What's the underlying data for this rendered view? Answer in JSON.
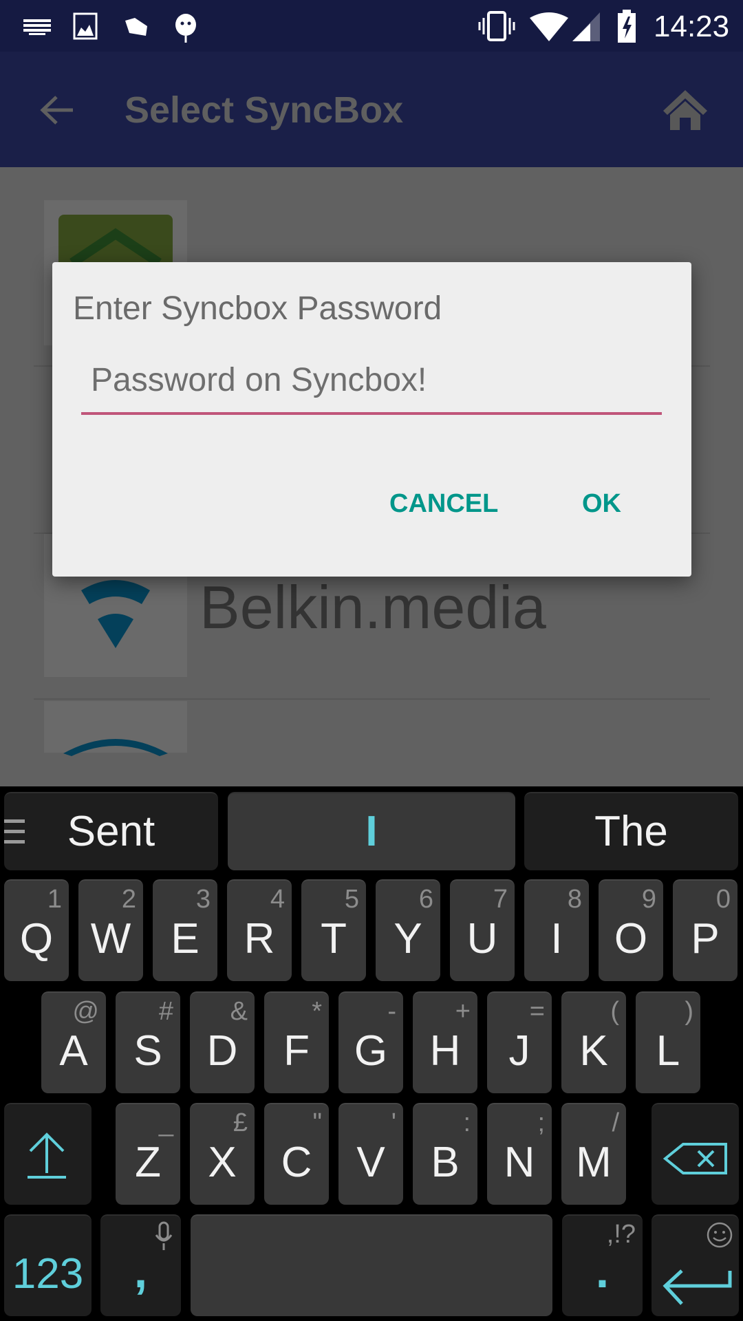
{
  "status_bar": {
    "time": "14:23",
    "left_icons": [
      "keyboard-icon",
      "image-icon",
      "cloud-icon",
      "android-debug-icon"
    ],
    "right_icons": [
      "vibrate-icon",
      "wifi-icon",
      "signal-icon",
      "battery-charging-icon"
    ]
  },
  "app_bar": {
    "title": "Select SyncBox",
    "back_icon": "arrow-left-icon",
    "home_icon": "home-icon"
  },
  "list": {
    "items": [
      {
        "label": ""
      },
      {
        "label": ""
      },
      {
        "label": "Belkin.media"
      },
      {
        "label": ""
      }
    ]
  },
  "dialog": {
    "title": "Enter Syncbox Password",
    "input_placeholder": "Password on Syncbox!",
    "input_value": "",
    "cancel_label": "CANCEL",
    "ok_label": "OK"
  },
  "keyboard": {
    "suggestions": [
      "Sent",
      "I",
      "The"
    ],
    "rows": [
      [
        {
          "k": "Q",
          "h": "1"
        },
        {
          "k": "W",
          "h": "2"
        },
        {
          "k": "E",
          "h": "3"
        },
        {
          "k": "R",
          "h": "4"
        },
        {
          "k": "T",
          "h": "5"
        },
        {
          "k": "Y",
          "h": "6"
        },
        {
          "k": "U",
          "h": "7"
        },
        {
          "k": "I",
          "h": "8"
        },
        {
          "k": "O",
          "h": "9"
        },
        {
          "k": "P",
          "h": "0"
        }
      ],
      [
        {
          "k": "A",
          "h": "@"
        },
        {
          "k": "S",
          "h": "#"
        },
        {
          "k": "D",
          "h": "&"
        },
        {
          "k": "F",
          "h": "*"
        },
        {
          "k": "G",
          "h": "-"
        },
        {
          "k": "H",
          "h": "+"
        },
        {
          "k": "J",
          "h": "="
        },
        {
          "k": "K",
          "h": "("
        },
        {
          "k": "L",
          "h": ")"
        }
      ],
      [
        {
          "k": "Z",
          "h": "_"
        },
        {
          "k": "X",
          "h": "£"
        },
        {
          "k": "C",
          "h": "\""
        },
        {
          "k": "V",
          "h": "'"
        },
        {
          "k": "B",
          "h": ":"
        },
        {
          "k": "N",
          "h": ";"
        },
        {
          "k": "M",
          "h": "/"
        }
      ]
    ],
    "numbers_label": "123",
    "comma_label": ",",
    "period_label": ".",
    "period_hint": ",!?",
    "accent": "#5fcfdb"
  }
}
